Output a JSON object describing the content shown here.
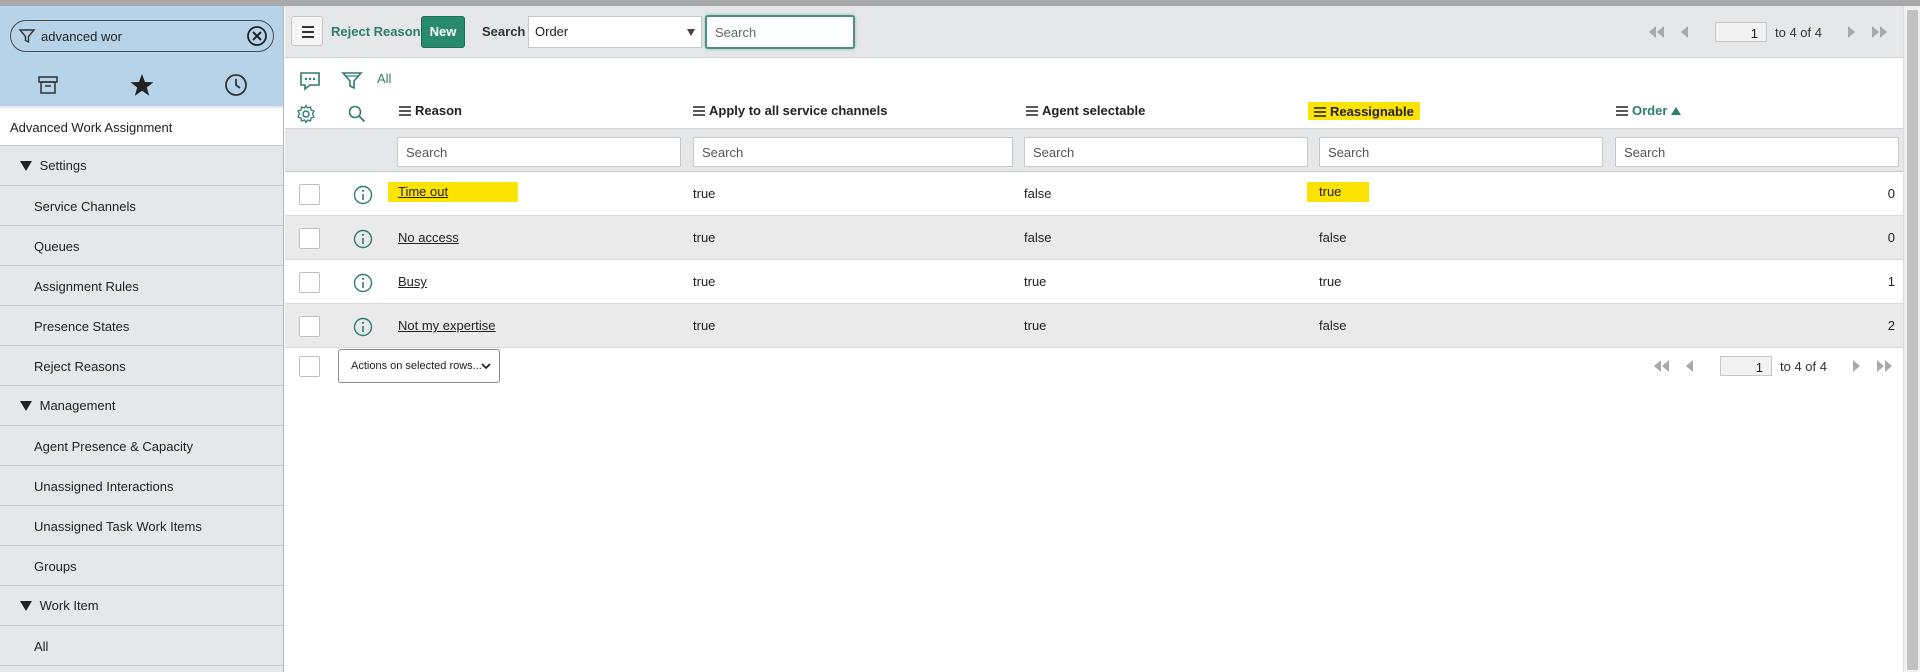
{
  "sidebar": {
    "filter_value": "advanced wor",
    "tabs": [
      {
        "name": "archive-icon"
      },
      {
        "name": "star-icon"
      },
      {
        "name": "history-icon"
      }
    ],
    "application": "Advanced Work Assignment",
    "sections": [
      {
        "label": "Settings",
        "items": [
          "Service Channels",
          "Queues",
          "Assignment Rules",
          "Presence States",
          "Reject Reasons"
        ]
      },
      {
        "label": "Management",
        "items": [
          "Agent Presence & Capacity",
          "Unassigned Interactions",
          "Unassigned Task Work Items",
          "Groups"
        ]
      },
      {
        "label": "Work Item",
        "items": [
          "All"
        ]
      }
    ]
  },
  "header": {
    "title": "Reject Reasons",
    "new_label": "New",
    "search_label": "Search",
    "field_select": "Order",
    "search_placeholder": "Search"
  },
  "pager": {
    "page": "1",
    "range_text": "to 4 of 4"
  },
  "filter_bar": {
    "breadcrumb_all": "All"
  },
  "columns": [
    {
      "label": "Reason",
      "highlighted": false,
      "sorted": false
    },
    {
      "label": "Apply to all service channels",
      "highlighted": false,
      "sorted": false
    },
    {
      "label": "Agent selectable",
      "highlighted": false,
      "sorted": false
    },
    {
      "label": "Reassignable",
      "highlighted": true,
      "sorted": false
    },
    {
      "label": "Order",
      "highlighted": false,
      "sorted": true,
      "sort_dir": "asc"
    }
  ],
  "column_search_placeholder": "Search",
  "rows": [
    {
      "reason": "Time out",
      "apply_all": "true",
      "agent_selectable": "false",
      "reassignable": "true",
      "order": "0",
      "highlight": true
    },
    {
      "reason": "No access",
      "apply_all": "true",
      "agent_selectable": "false",
      "reassignable": "false",
      "order": "0",
      "highlight": false
    },
    {
      "reason": "Busy",
      "apply_all": "true",
      "agent_selectable": "true",
      "reassignable": "true",
      "order": "1",
      "highlight": false
    },
    {
      "reason": "Not my expertise",
      "apply_all": "true",
      "agent_selectable": "true",
      "reassignable": "false",
      "order": "2",
      "highlight": false
    }
  ],
  "footer": {
    "actions_label": "Actions on selected rows..."
  },
  "colors": {
    "accent": "#2e7c6f",
    "new_button": "#278a6e",
    "highlight": "#fce300",
    "sidebar_head": "#b7d3ea"
  }
}
